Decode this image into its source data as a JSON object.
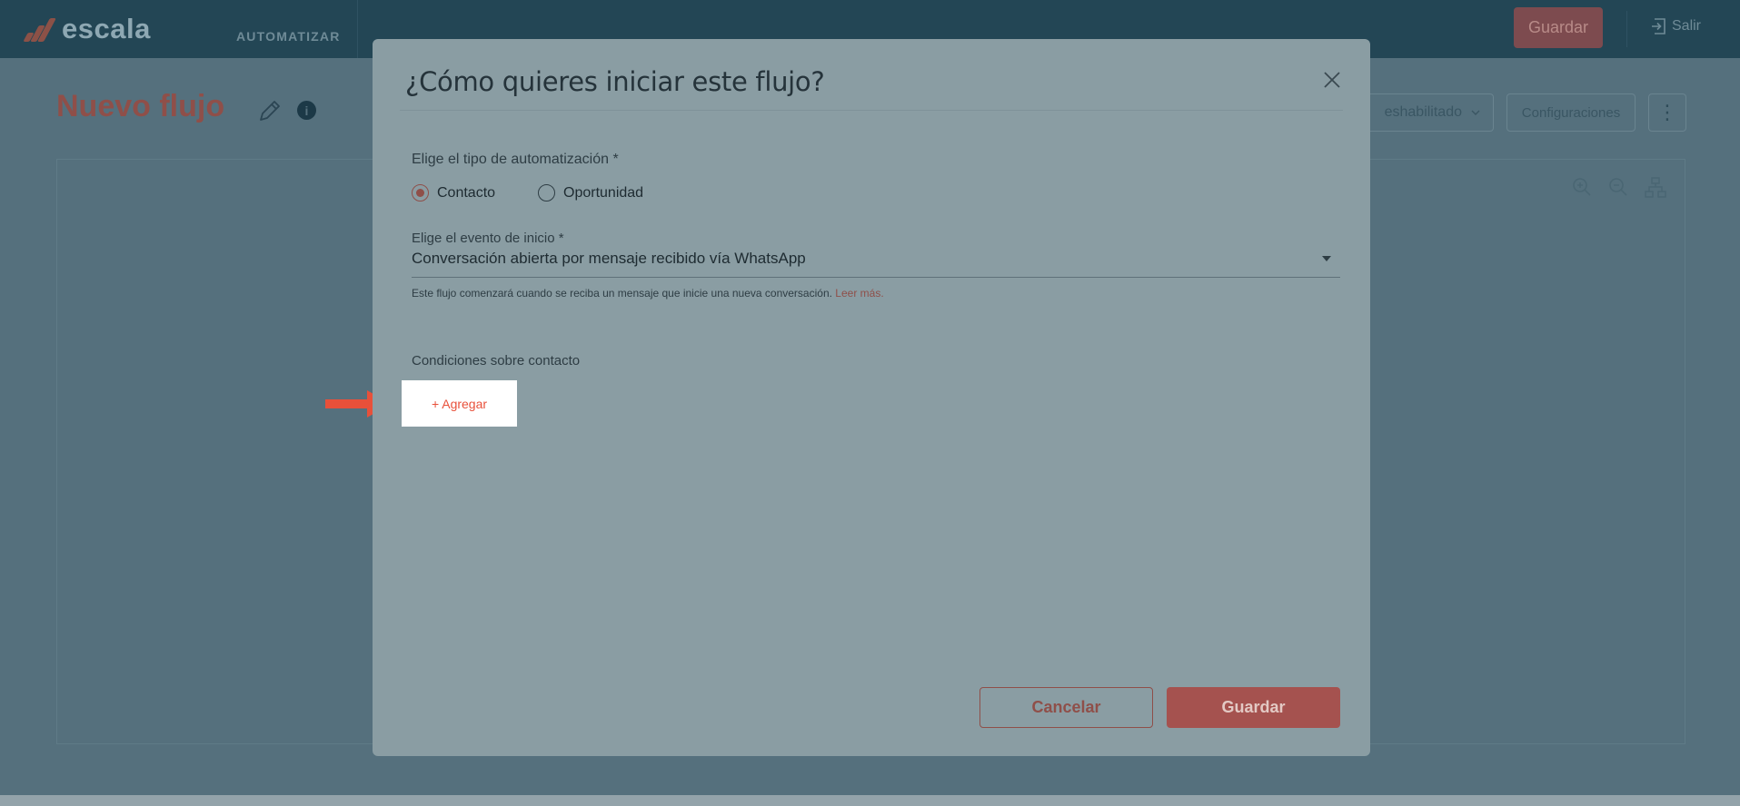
{
  "header": {
    "logo_text": "escala",
    "nav_label": "AUTOMATIZAR",
    "save_label": "Guardar",
    "exit_label": "Salir"
  },
  "page": {
    "title": "Nuevo flujo",
    "status_label": "eshabilitado",
    "config_label": "Configuraciones",
    "more_label": "⋮"
  },
  "modal": {
    "title": "¿Cómo quieres iniciar este flujo?",
    "automation_type_label": "Elige el tipo de automatización *",
    "options": [
      "Contacto",
      "Oportunidad"
    ],
    "selected_option": "Contacto",
    "start_event_label": "Elige el evento de inicio *",
    "start_event_value": "Conversación abierta por mensaje recibido vía WhatsApp",
    "helper_text": "Este flujo comenzará cuando se reciba un mensaje que inicie una nueva conversación.",
    "helper_link": "Leer más.",
    "conditions_label": "Condiciones sobre contacto",
    "add_label": "+ Agregar",
    "cancel_label": "Cancelar",
    "save_label": "Guardar"
  },
  "colors": {
    "brand": "#e8503a",
    "overlay": "#55707d",
    "modal_bg": "#8a9da3"
  }
}
